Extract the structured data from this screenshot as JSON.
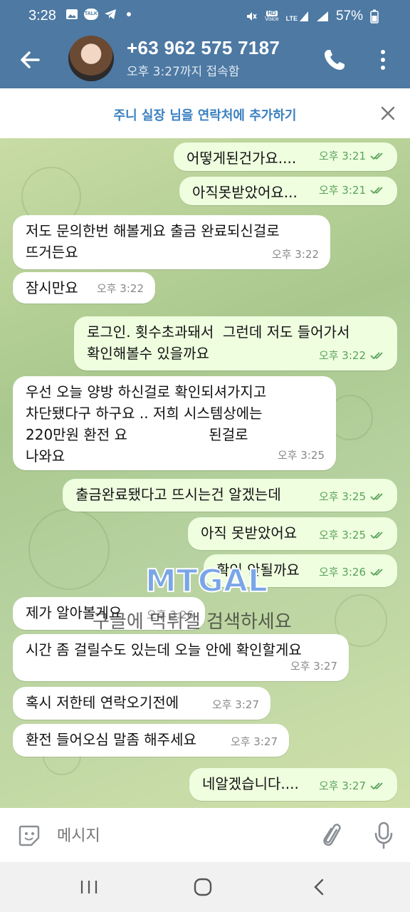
{
  "status_bar": {
    "time": "3:28",
    "talk_label": "TALK",
    "network_hd": "HD",
    "network_voice": "Voice",
    "network_lte": "LTE",
    "battery": "57%"
  },
  "header": {
    "contact_name": "+63 962 575 7187",
    "contact_status": "오후 3:27까지 접속함"
  },
  "add_bar": {
    "label": "주니 실장 님을 연락처에 추가하기"
  },
  "messages": [
    {
      "text": "어떻게된건가요....",
      "time": "오후 3:21",
      "dir": "out"
    },
    {
      "text": "아직못받았어요...",
      "time": "오후 3:21",
      "dir": "out"
    },
    {
      "text": "저도 문의한번 해볼게요 출금 완료되신걸로\n뜨거든요",
      "time": "오후 3:22",
      "dir": "in"
    },
    {
      "text": "잠시만요",
      "time": "오후 3:22",
      "dir": "in"
    },
    {
      "text": "로그인. 횟수초과돼서  그런데 저도 들어가서\n확인해볼수 있을까요",
      "time": "오후 3:22",
      "dir": "out"
    },
    {
      "text": "우선 오늘 양방 하신걸로 확인되셔가지고\n차단됐다구 하구요 .. 저희 시스템상에는\n220만원 환전 요                  된걸로\n나와요",
      "time": "오후 3:25",
      "dir": "in"
    },
    {
      "text": "출금완료됐다고 뜨시는건 알겠는데",
      "time": "오후 3:25",
      "dir": "out"
    },
    {
      "text": "아직 못받았어요",
      "time": "오후 3:25",
      "dir": "out"
    },
    {
      "text": "확인 안될까요",
      "time": "오후 3:26",
      "dir": "out"
    },
    {
      "text": "제가 알아볼게요",
      "time": "오후 3:26",
      "dir": "in"
    },
    {
      "text": "시간 좀 걸릴수도 있는데 오늘 안에 확인할게요",
      "time": "오후 3:27",
      "dir": "in"
    },
    {
      "text": "혹시 저한테 연락오기전에",
      "time": "오후 3:27",
      "dir": "in"
    },
    {
      "text": "환전 들어오심 말좀 해주세요",
      "time": "오후 3:27",
      "dir": "in"
    },
    {
      "text": "네알겠습니다....",
      "time": "오후 3:27",
      "dir": "out"
    }
  ],
  "watermark": {
    "logo": "MTGAL",
    "text": "구글에 먹튀갤 검색하세요"
  },
  "input_bar": {
    "placeholder": "메시지"
  },
  "colors": {
    "header": "#4d79a3",
    "accent": "#3a80c0",
    "outgoing_bubble": "#eefedf",
    "incoming_bubble": "#ffffff",
    "check": "#5aa35a"
  },
  "icons": {
    "back": "arrow-left-icon",
    "call": "phone-icon",
    "more": "more-vertical-icon",
    "close": "close-icon",
    "emoji": "sticker-icon",
    "attach": "paperclip-icon",
    "mic": "microphone-icon"
  }
}
